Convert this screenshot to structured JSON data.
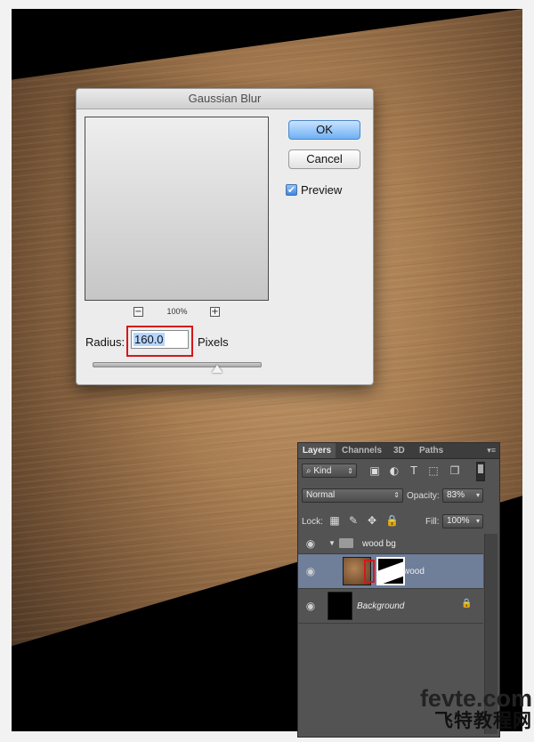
{
  "dialog": {
    "title": "Gaussian Blur",
    "ok_label": "OK",
    "cancel_label": "Cancel",
    "preview_checked": true,
    "preview_label": "Preview",
    "zoom_minus": "−",
    "zoom_plus": "+",
    "zoom_level": "100%",
    "radius_label": "Radius:",
    "radius_value": "160.0",
    "units_label": "Pixels",
    "check_mark": "✔"
  },
  "layers_panel": {
    "tabs": [
      "Layers",
      "Channels",
      "3D",
      "Paths"
    ],
    "menu_icon": "▾≡",
    "kind_label": "Kind",
    "filter_icons": [
      "image-filter-icon",
      "adjustment-filter-icon",
      "type-filter-icon",
      "shape-filter-icon",
      "smart-object-filter-icon"
    ],
    "blend_mode": "Normal",
    "opacity_label": "Opacity:",
    "opacity_value": "83%",
    "lock_label": "Lock:",
    "fill_label": "Fill:",
    "fill_value": "100%",
    "layers": [
      {
        "name": "wood bg",
        "type": "group"
      },
      {
        "name": "wood",
        "type": "layer",
        "selected": true
      },
      {
        "name": "Background",
        "type": "background",
        "locked": true
      }
    ]
  },
  "watermark": {
    "line1": "fevte.com",
    "line2": "飞特教程网"
  },
  "colors": {
    "highlight_red": "#d3181a",
    "ok_blue": "#6fb0f4",
    "selected_layer": "#6f7e99"
  }
}
